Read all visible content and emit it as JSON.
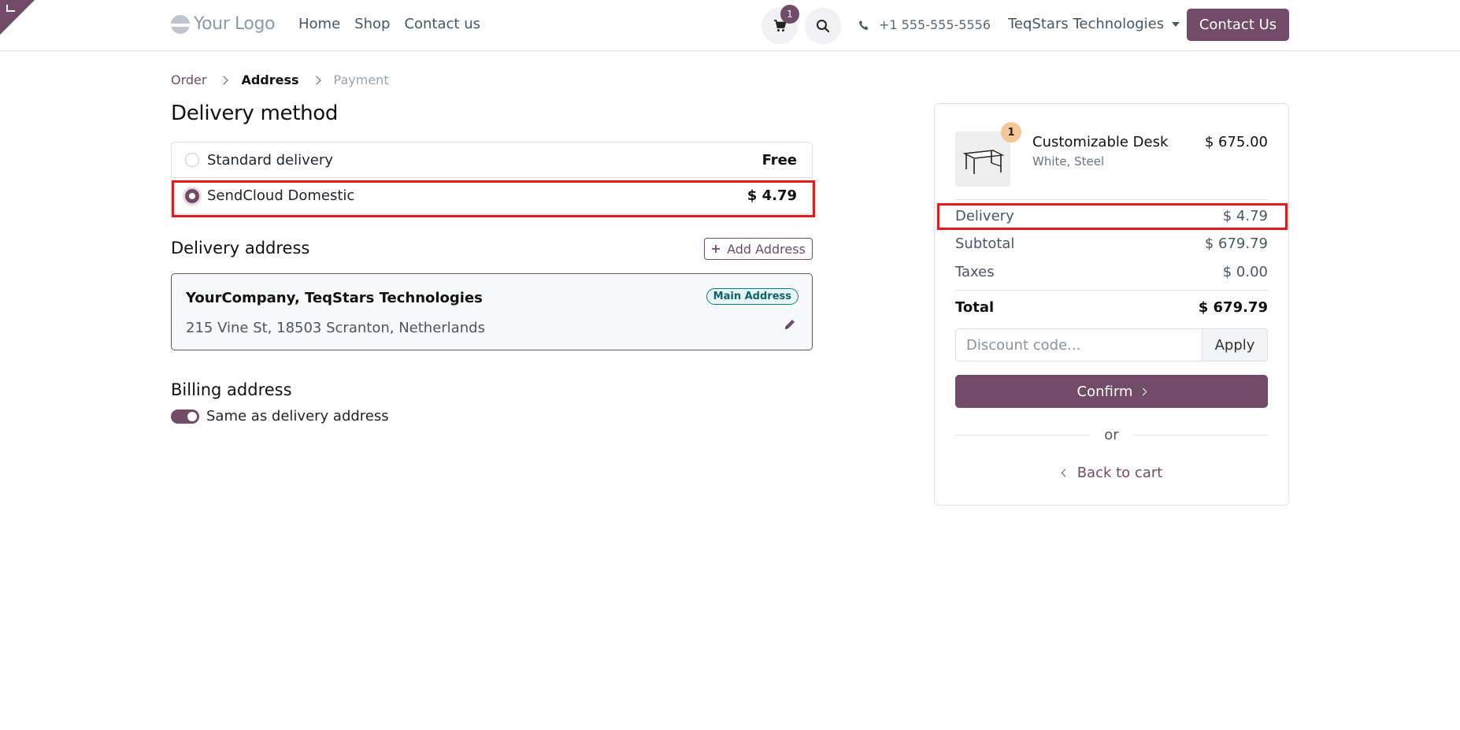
{
  "header": {
    "logo_text": "Your Logo",
    "nav": [
      "Home",
      "Shop",
      "Contact us"
    ],
    "cart_count": "1",
    "phone": "+1 555-555-5556",
    "company": "TeqStars Technologies",
    "contact_button": "Contact Us",
    "accent_color": "#714b67"
  },
  "breadcrumb": {
    "order": "Order",
    "address": "Address",
    "payment": "Payment"
  },
  "delivery_method": {
    "title": "Delivery method",
    "options": [
      {
        "label": "Standard delivery",
        "price": "Free",
        "selected": false
      },
      {
        "label": "SendCloud Domestic",
        "price": "$ 4.79",
        "selected": true
      }
    ]
  },
  "delivery_address": {
    "title": "Delivery address",
    "add_button": "Add Address",
    "card": {
      "name": "YourCompany, TeqStars Technologies",
      "address": "215 Vine St, 18503 Scranton, Netherlands",
      "badge": "Main Address"
    }
  },
  "billing_address": {
    "title": "Billing address",
    "toggle_label": "Same as delivery address",
    "toggle_on": true
  },
  "summary": {
    "product": {
      "name": "Customizable Desk",
      "variant": "White, Steel",
      "price": "$ 675.00",
      "quantity": "1"
    },
    "delivery_label": "Delivery",
    "delivery_value": "$ 4.79",
    "subtotal_label": "Subtotal",
    "subtotal_value": "$ 679.79",
    "taxes_label": "Taxes",
    "taxes_value": "$ 0.00",
    "total_label": "Total",
    "total_value": "$ 679.79",
    "discount_placeholder": "Discount code...",
    "apply_button": "Apply",
    "confirm_button": "Confirm",
    "or_text": "or",
    "back_link": "Back to cart"
  },
  "highlight_color": "#e51b1b"
}
